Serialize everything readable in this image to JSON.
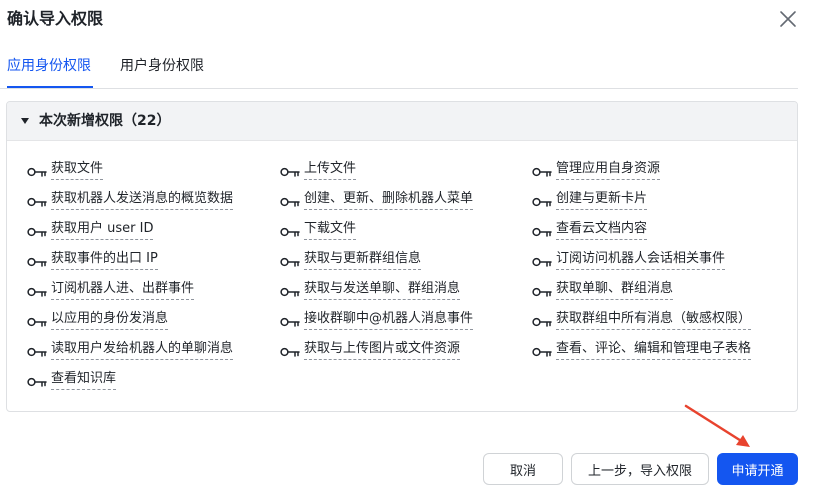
{
  "dialog": {
    "title": "确认导入权限"
  },
  "tabs": [
    {
      "label": "应用身份权限",
      "active": true
    },
    {
      "label": "用户身份权限",
      "active": false
    }
  ],
  "section": {
    "title": "本次新增权限（22）"
  },
  "permissions": {
    "col1": [
      "获取文件",
      "获取机器人发送消息的概览数据",
      "获取用户 user ID",
      "获取事件的出口 IP",
      "订阅机器人进、出群事件",
      "以应用的身份发消息",
      "读取用户发给机器人的单聊消息",
      "查看知识库"
    ],
    "col2": [
      "上传文件",
      "创建、更新、删除机器人菜单",
      "下载文件",
      "获取与更新群组信息",
      "获取与发送单聊、群组消息",
      "接收群聊中@机器人消息事件",
      "获取与上传图片或文件资源"
    ],
    "col3": [
      "管理应用自身资源",
      "创建与更新卡片",
      "查看云文档内容",
      "订阅访问机器人会话相关事件",
      "获取单聊、群组消息",
      "获取群组中所有消息（敏感权限）",
      "查看、评论、编辑和管理电子表格"
    ]
  },
  "footer": {
    "cancel_label": "取消",
    "back_label": "上一步，导入权限",
    "apply_label": "申请开通"
  },
  "colors": {
    "accent": "#1456f0",
    "annotation_arrow": "#e8432e"
  },
  "icons": {
    "permission": "key-icon",
    "close": "close-icon",
    "collapse": "caret-down-icon"
  }
}
